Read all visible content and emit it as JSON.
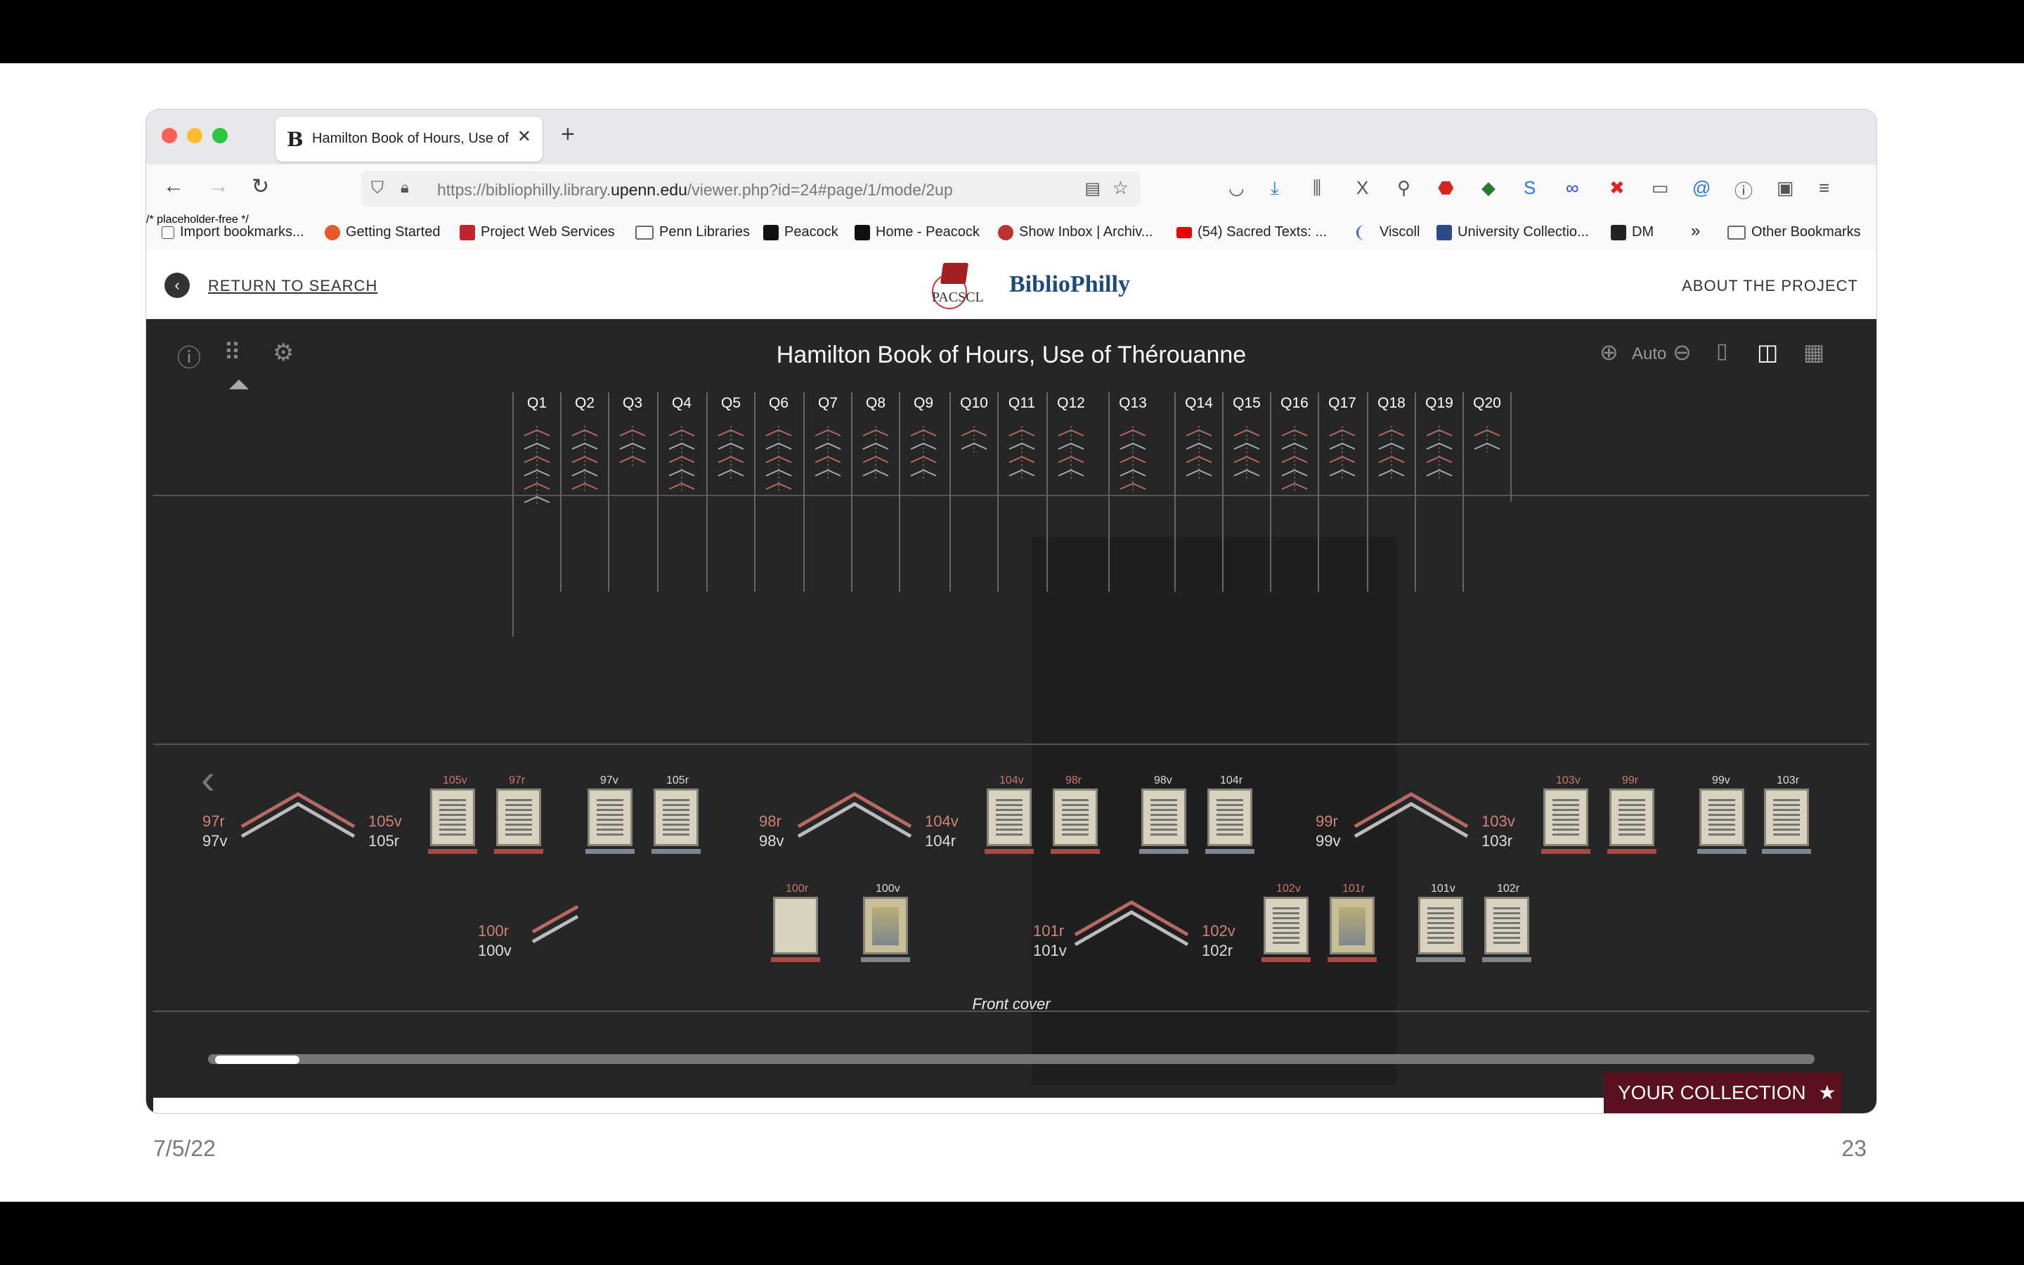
{
  "slide": {
    "date": "7/5/22",
    "page_number": "23"
  },
  "browser": {
    "tab_title": "Hamilton Book of Hours, Use of",
    "tab_close": "✕",
    "new_tab": "+",
    "url_host": "https://bibliophilly.library.",
    "url_domain": "upenn.edu",
    "url_path": "/viewer.php?id=24#page/1/mode/2up",
    "bookmarks": [
      {
        "label": "Import bookmarks...",
        "color": "#555"
      },
      {
        "label": "Getting Started",
        "color": "#e8582a"
      },
      {
        "label": "Project Web Services",
        "color": "#c0262d"
      },
      {
        "label": "Penn Libraries",
        "color": "#888"
      },
      {
        "label": "Peacock",
        "color": "#111"
      },
      {
        "label": "Home - Peacock",
        "color": "#111"
      },
      {
        "label": "Show Inbox | Archiv...",
        "color": "#b33"
      },
      {
        "label": "(54) Sacred Texts: ...",
        "color": "#e00"
      },
      {
        "label": "Viscoll",
        "color": "#3a66c4"
      },
      {
        "label": "University Collectio...",
        "color": "#2a4a8a"
      },
      {
        "label": "DM",
        "color": "#222"
      },
      {
        "label": "Other Bookmarks",
        "color": "#888"
      }
    ]
  },
  "site": {
    "return_label": "RETURN TO SEARCH",
    "logo_small": "PACSCL",
    "logo_name": "BiblioPhilly",
    "about_label": "ABOUT THE PROJECT"
  },
  "viewer": {
    "title": "Hamilton Book of Hours, Use of Thérouanne",
    "zoom_label": "Auto",
    "quires": [
      "Q1",
      "Q2",
      "Q3",
      "Q4",
      "Q5",
      "Q6",
      "Q7",
      "Q8",
      "Q9",
      "Q10",
      "Q11",
      "Q12",
      "Q13",
      "Q14",
      "Q15",
      "Q16",
      "Q17",
      "Q18",
      "Q19",
      "Q20"
    ],
    "caption": "Front cover",
    "collection_label": "YOUR COLLECTION",
    "row1": [
      {
        "left_top": "97r",
        "left_bottom": "97v",
        "right_top": "105v",
        "right_bottom": "105r",
        "thumbs": [
          {
            "label": "105v",
            "color": "pink"
          },
          {
            "label": "97r",
            "color": "pink"
          },
          {
            "label": "97v",
            "color": "white"
          },
          {
            "label": "105r",
            "color": "white"
          }
        ]
      },
      {
        "left_top": "98r",
        "left_bottom": "98v",
        "right_top": "104v",
        "right_bottom": "104r",
        "thumbs": [
          {
            "label": "104v",
            "color": "pink"
          },
          {
            "label": "98r",
            "color": "pink"
          },
          {
            "label": "98v",
            "color": "white"
          },
          {
            "label": "104r",
            "color": "white"
          }
        ]
      },
      {
        "left_top": "99r",
        "left_bottom": "99v",
        "right_top": "103v",
        "right_bottom": "103r",
        "thumbs": [
          {
            "label": "103v",
            "color": "pink"
          },
          {
            "label": "99r",
            "color": "pink"
          },
          {
            "label": "99v",
            "color": "white"
          },
          {
            "label": "103r",
            "color": "white"
          }
        ]
      }
    ],
    "row2": [
      {
        "left_top": "100r",
        "left_bottom": "100v",
        "thumbs": [
          {
            "label": "100r",
            "color": "pink"
          },
          {
            "label": "100v",
            "color": "white"
          }
        ]
      },
      {
        "left_top": "101r",
        "left_bottom": "101v",
        "right_top": "102v",
        "right_bottom": "102r",
        "thumbs": [
          {
            "label": "102v",
            "color": "pink"
          },
          {
            "label": "101r",
            "color": "pink"
          },
          {
            "label": "101v",
            "color": "white"
          },
          {
            "label": "102r",
            "color": "white"
          }
        ]
      }
    ]
  }
}
